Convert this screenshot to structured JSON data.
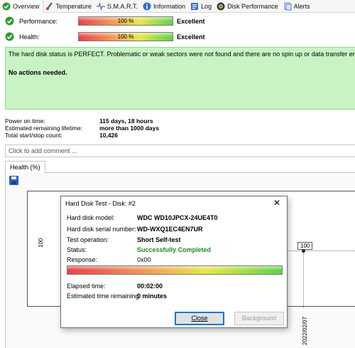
{
  "tabs": [
    {
      "label": "Overview",
      "icon": "check-circle-icon"
    },
    {
      "label": "Temperature",
      "icon": "thermometer-icon"
    },
    {
      "label": "S.M.A.R.T.",
      "icon": "wave-icon"
    },
    {
      "label": "Information",
      "icon": "info-icon"
    },
    {
      "label": "Log",
      "icon": "log-icon"
    },
    {
      "label": "Disk Performance",
      "icon": "disk-icon"
    },
    {
      "label": "Alerts",
      "icon": "alerts-icon"
    }
  ],
  "metrics": [
    {
      "label": "Performance:",
      "value": "100 %",
      "level": 1.0,
      "result": "Excellent"
    },
    {
      "label": "Health:",
      "value": "100 %",
      "level": 1.0,
      "result": "Excellent"
    }
  ],
  "status": {
    "message": "The hard disk status is PERFECT. Problematic or weak sectors were not found and there are no spin up or data transfer errors.",
    "actions": "No actions needed.",
    "color": "#c8f4c4"
  },
  "info": [
    {
      "key": "Power on time:",
      "value": "115 days, 18 hours"
    },
    {
      "key": "Estimated remaining lifetime:",
      "value": "more than 1000 days"
    },
    {
      "key": "Total start/stop count:",
      "value": "10,426"
    }
  ],
  "comment_placeholder": "Click to add comment ...",
  "health_tab": "Health (%)",
  "chart": {
    "y_tick": "100",
    "point_label": "100",
    "x_tick": "2022/02/07"
  },
  "dialog": {
    "title": "Hard Disk Test - Disk: #2",
    "fields": [
      {
        "label": "Hard disk model:",
        "value": "WDC WD10JPCX-24UE4T0"
      },
      {
        "label": "Hard disk serial number:",
        "value": "WD-WXQ1EC4EN7UR"
      },
      {
        "label": "Test operation:",
        "value": "Short Self-test"
      },
      {
        "label": "Status:",
        "value": "Successfully Completed"
      },
      {
        "label": "Response:",
        "value": "0x00"
      }
    ],
    "progress": 1.0,
    "elapsed_label": "Elapsed time:",
    "elapsed_value": "00:02:00",
    "remaining_label": "Estimated time remaining:",
    "remaining_value": "0 minutes",
    "close_button": "Close",
    "background_button": "Background",
    "status_color": "#1f8c1f"
  }
}
